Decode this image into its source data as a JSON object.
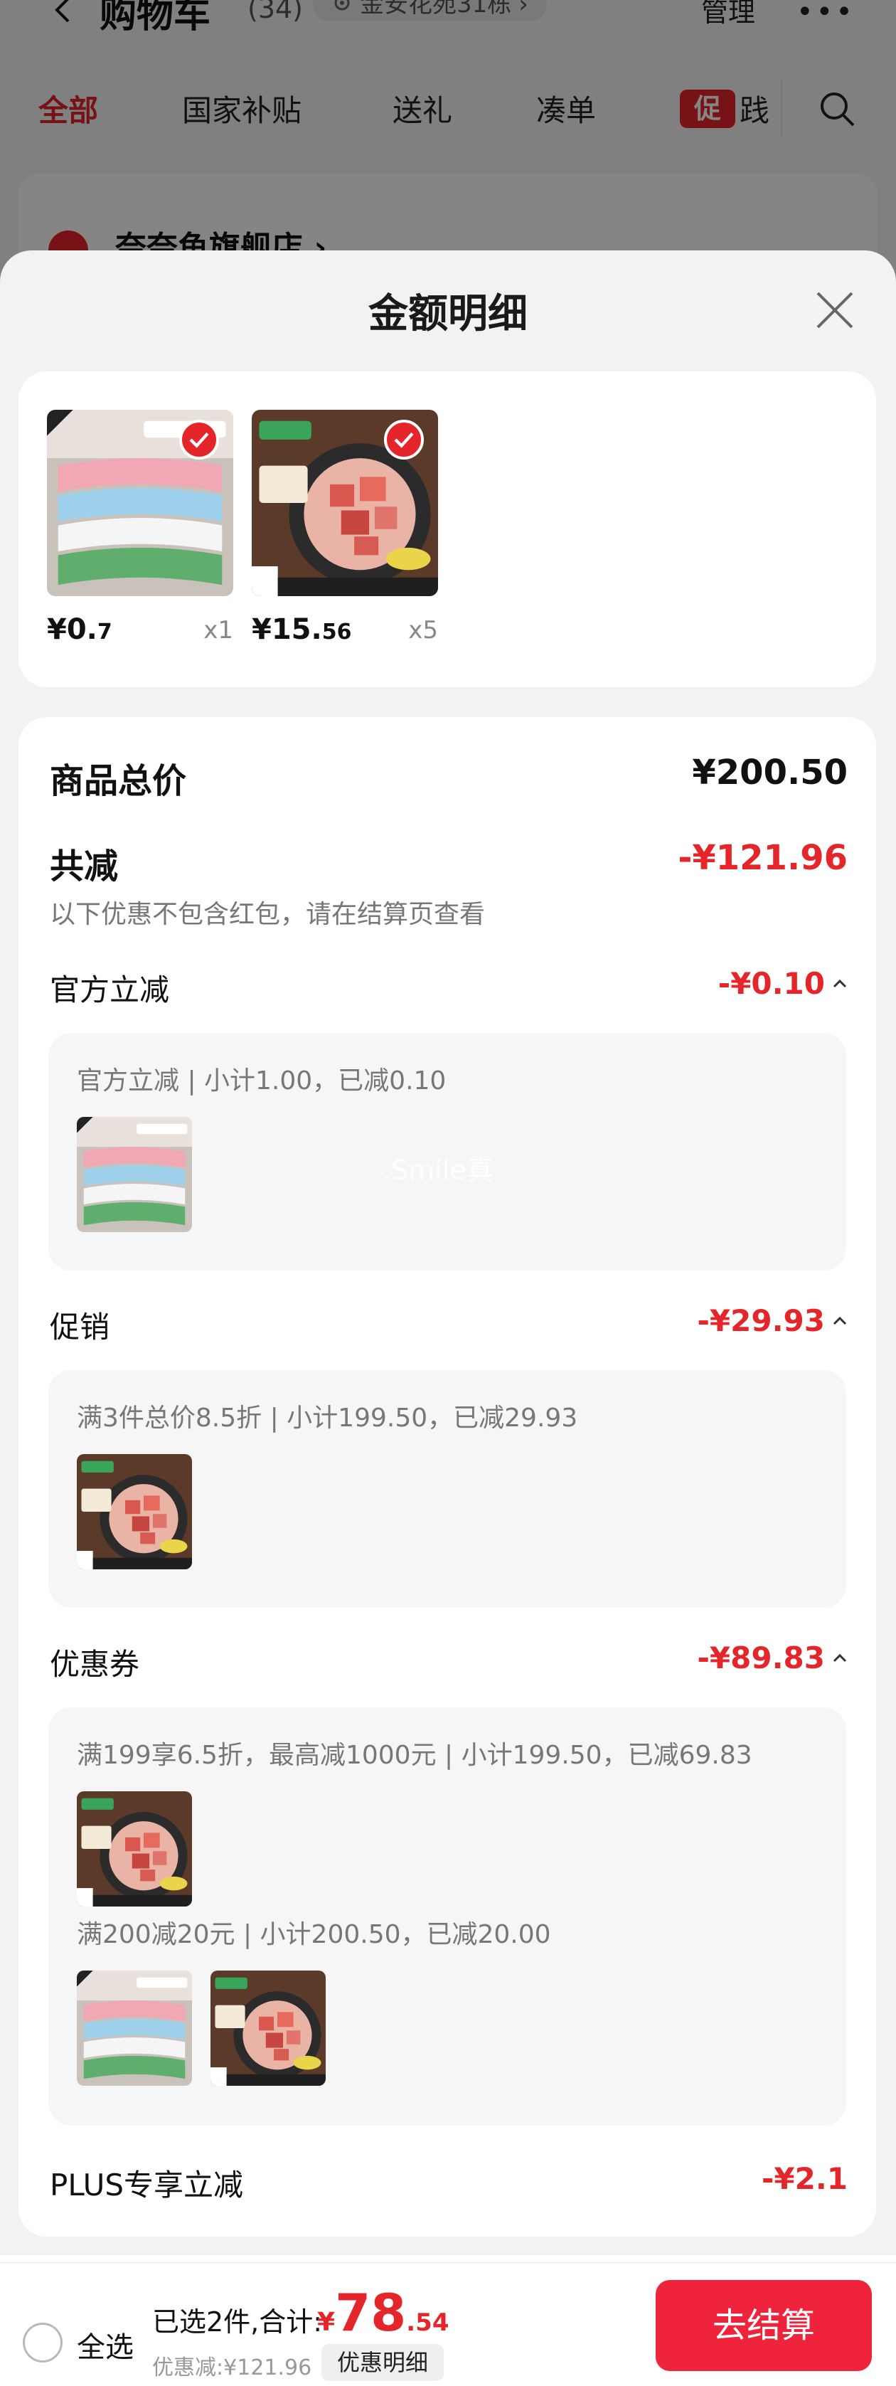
{
  "background": {
    "title": "购物车",
    "count": "(34)",
    "address": "金安花苑31栋",
    "address_arrow": "›",
    "manage": "管理",
    "more": "•••",
    "tabs": [
      "全部",
      "国家补贴",
      "送礼",
      "凑单"
    ],
    "promo_tag": "促",
    "promo_rest": "践",
    "store_name": "奈奈鱼旗舰店 ›"
  },
  "sheet": {
    "title": "金额明细",
    "products": [
      {
        "price_main": "¥0.",
        "price_small": "7",
        "qty": "x1",
        "image": "dishcloth-image"
      },
      {
        "price_main": "¥15.",
        "price_small": "56",
        "qty": "x5",
        "image": "beef-cubes-image"
      }
    ],
    "total_label": "商品总价",
    "total_value": "¥200.50",
    "reduction_label": "共减",
    "reduction_value": "-¥121.96",
    "reduction_note": "以下优惠不包含红包，请在结算页查看",
    "official": {
      "label": "官方立减",
      "value": "-¥0.10",
      "detail": "官方立减 | 小计1.00，已减0.10",
      "watermark": ".Smile真"
    },
    "promo": {
      "label": "促销",
      "value": "-¥29.93",
      "detail": "满3件总价8.5折 | 小计199.50，已减29.93"
    },
    "coupon": {
      "label": "优惠券",
      "value": "-¥89.83",
      "detail1": "满199享6.5折，最高减1000元 | 小计199.50，已减69.83",
      "detail2": "满200减20元 | 小计200.50，已减20.00"
    },
    "plus": {
      "label": "PLUS专享立减",
      "value": "-¥2.1"
    }
  },
  "bottom_bar": {
    "select_all": "全选",
    "summary": "已选2件,合计:",
    "yen": "¥",
    "total_int": "78",
    "total_cents": ".54",
    "discount": "优惠减:¥121.96",
    "detail_button": "优惠明细",
    "checkout": "去结算"
  },
  "colors": {
    "accent_red": "#e4262b",
    "checkout_red": "#f0233c"
  }
}
